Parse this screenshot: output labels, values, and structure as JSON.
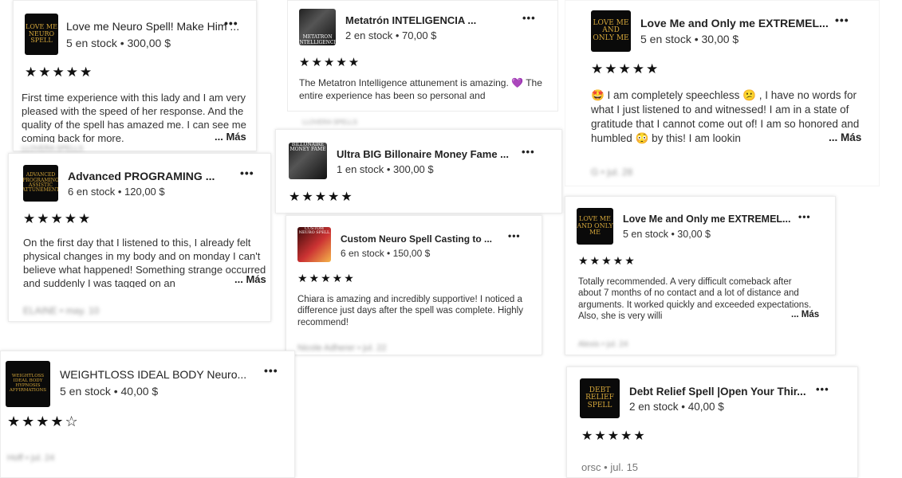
{
  "cards": [
    {
      "thumb": "LOVE ME NEURO SPELL",
      "title": "Love me  Neuro Spell! Make Him ...",
      "stock": "5 en stock • 300,00 $",
      "stars": "★★★★★",
      "review": "First time experience with this lady and I am very pleased with the speed of her response. And the quality of the spell  has amazed me. I can see me coming back for more.",
      "more": "... Más",
      "meta": "LLOVERA SPELLS"
    },
    {
      "thumb": "METATRON INTELLIGENCE",
      "title": "Metatrón INTELIGENCIA ...",
      "stock": "2 en stock • 70,00 $",
      "stars": "★★★★★",
      "review": "The Metatron Intelligence attunement is amazing. 💜 The entire experience has been so personal and",
      "meta": "LLOVERA SPELLS"
    },
    {
      "thumb": "LOVE ME AND ONLY ME",
      "title": "Love Me and Only me EXTREMEL...",
      "stock": "5 en stock • 30,00 $",
      "stars": "★★★★★",
      "review": "🤩 I am completely speechless 😕 , I have no words for what I just listened to and witnessed! I am in a state of gratitude that I cannot come out of! I am so honored and  humbled 😳  by this! I am lookin",
      "more": "... Más",
      "meta": "G • jul. 28"
    },
    {
      "thumb": "ADVANCED PROGRAMING ASSISTIC ATTUNEMENT",
      "title": "Advanced PROGRAMING ...",
      "stock": "6 en stock • 120,00 $",
      "stars": "★★★★★",
      "review": "On the first day that I listened to this, I already felt physical changes in my body and on monday I can't believe what happened! Something strange occurred and suddenly I was tagged on an",
      "more": "... Más",
      "meta": "ELAINE • may. 10"
    },
    {
      "thumb": "BILLONAIRE MONEY FAME",
      "title": "Ultra BIG Billonaire Money Fame ...",
      "stock": "1 en stock • 300,00 $",
      "stars": "★★★★★"
    },
    {
      "thumb": "CUSTOM NEURO SPELL",
      "title": "Custom Neuro Spell Casting to ...",
      "stock": "6 en stock • 150,00 $",
      "stars": "★★★★★",
      "review": "Chiara is amazing and incredibly supportive! I noticed a difference just days after the spell was complete. Highly recommend!",
      "meta": "Nicole Adherer • jul. 22"
    },
    {
      "thumb": "LOVE ME AND ONLY ME",
      "title": "Love Me and Only me EXTREMEL...",
      "stock": "5 en stock • 30,00 $",
      "stars": "★★★★★",
      "review": "Totally recommended. A very difficult comeback after about 7 months of no contact and a lot of distance and arguments. It worked quickly and exceeded expectations. Also, she is very willi",
      "more": "... Más",
      "meta": "Alexis • jul. 24"
    },
    {
      "thumb": "WEIGHTLOSS IDEAL BODY HYPNOSIS AFFIRMATIONS",
      "title": "WEIGHTLOSS IDEAL BODY Neuro...",
      "stock": "5 en stock • 40,00 $",
      "stars": "★★★★☆",
      "meta": "Hoff • jul. 24"
    },
    {
      "thumb": "DEBT RELIEF SPELL",
      "title": "Debt Relief Spell |Open Your Thir...",
      "stock": "2 en stock • 40,00 $",
      "stars": "★★★★★",
      "meta": "orsc • jul. 15"
    }
  ],
  "more_options": "•••"
}
